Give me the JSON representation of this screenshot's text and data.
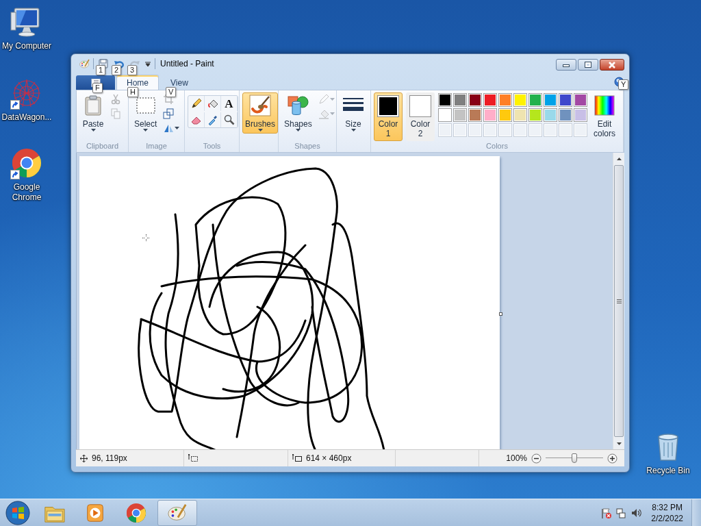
{
  "desktop_icons": [
    {
      "label": "My Computer",
      "kind": "computer",
      "shortcut": false
    },
    {
      "label": "DataWagon...",
      "kind": "datawagon",
      "shortcut": true
    },
    {
      "label": "Google Chrome",
      "kind": "chrome",
      "shortcut": true
    },
    {
      "label": "Recycle Bin",
      "kind": "recycle",
      "shortcut": false
    }
  ],
  "window": {
    "title": "Untitled - Paint",
    "quick_access": [
      {
        "kind": "save",
        "keytip": "1",
        "disabled": false
      },
      {
        "kind": "undo",
        "keytip": "2",
        "disabled": false
      },
      {
        "kind": "redo",
        "keytip": "3",
        "disabled": true
      }
    ],
    "file_tab": {
      "keytip": "F"
    },
    "tabs": [
      {
        "label": "Home",
        "keytip": "H",
        "selected": true
      },
      {
        "label": "View",
        "keytip": "V",
        "selected": false
      }
    ],
    "help_keytip": "Y",
    "ribbon_groups": [
      {
        "label": "Clipboard",
        "controls": [
          {
            "kind": "paste",
            "label": "Paste",
            "dropdown": true,
            "selected": false
          },
          {
            "kind": "icon_column",
            "icons": [
              {
                "kind": "cut",
                "disabled": true,
                "dropdown": false
              },
              {
                "kind": "copy",
                "disabled": true,
                "dropdown": false
              }
            ]
          }
        ]
      },
      {
        "label": "Image",
        "controls": [
          {
            "kind": "select",
            "label": "Select",
            "dropdown": true,
            "selected": false
          },
          {
            "kind": "icon_column",
            "icons": [
              {
                "kind": "crop",
                "disabled": true,
                "dropdown": false
              },
              {
                "kind": "resize",
                "disabled": false,
                "dropdown": false
              },
              {
                "kind": "rotate",
                "disabled": false,
                "dropdown": true
              }
            ]
          }
        ]
      },
      {
        "label": "Tools",
        "controls": [
          {
            "kind": "tool_grid",
            "tools": [
              {
                "kind": "pencil"
              },
              {
                "kind": "fill"
              },
              {
                "kind": "text",
                "glyph": "A"
              },
              {
                "kind": "eraser"
              },
              {
                "kind": "picker"
              },
              {
                "kind": "magnifier"
              }
            ]
          }
        ]
      },
      {
        "controls": [
          {
            "kind": "brush",
            "label": "Brushes",
            "dropdown": true,
            "selected": true
          }
        ]
      },
      {
        "label": "Shapes",
        "controls": [
          {
            "kind": "shapes",
            "label": "Shapes",
            "dropdown": true,
            "selected": false
          },
          {
            "kind": "icon_column",
            "icons": [
              {
                "kind": "outline",
                "disabled": true,
                "dropdown": true
              },
              {
                "kind": "shape_fill",
                "disabled": true,
                "dropdown": true
              }
            ]
          }
        ]
      },
      {
        "controls": [
          {
            "kind": "size",
            "label": "Size",
            "dropdown": true,
            "selected": false
          }
        ]
      },
      {
        "label": "Colors",
        "controls": [
          {
            "kind": "color_slot",
            "label": "Color 1",
            "color": "#000000",
            "selected": true
          },
          {
            "kind": "color_slot",
            "label": "Color 2",
            "color": "#ffffff",
            "selected": false
          },
          {
            "kind": "palette",
            "rows": [
              [
                {
                  "kind": "swatch",
                  "color": "#000000"
                },
                {
                  "kind": "swatch",
                  "color": "#7f7f7f"
                },
                {
                  "kind": "swatch",
                  "color": "#880015"
                },
                {
                  "kind": "swatch",
                  "color": "#ed1c24"
                },
                {
                  "kind": "swatch",
                  "color": "#ff7f27"
                },
                {
                  "kind": "swatch",
                  "color": "#fff200"
                },
                {
                  "kind": "swatch",
                  "color": "#22b14c"
                },
                {
                  "kind": "swatch",
                  "color": "#00a2e8"
                },
                {
                  "kind": "swatch",
                  "color": "#3f48cc"
                },
                {
                  "kind": "swatch",
                  "color": "#a349a4"
                }
              ],
              [
                {
                  "kind": "swatch",
                  "color": "#ffffff"
                },
                {
                  "kind": "swatch",
                  "color": "#c3c3c3"
                },
                {
                  "kind": "swatch",
                  "color": "#b97a57"
                },
                {
                  "kind": "swatch",
                  "color": "#ffaec9"
                },
                {
                  "kind": "swatch",
                  "color": "#ffc90e"
                },
                {
                  "kind": "swatch",
                  "color": "#efe4b0"
                },
                {
                  "kind": "swatch",
                  "color": "#b5e61d"
                },
                {
                  "kind": "swatch",
                  "color": "#99d9ea"
                },
                {
                  "kind": "swatch",
                  "color": "#7092be"
                },
                {
                  "kind": "swatch",
                  "color": "#c8bfe7"
                }
              ],
              [
                {
                  "kind": "empty"
                },
                {
                  "kind": "empty"
                },
                {
                  "kind": "empty"
                },
                {
                  "kind": "empty"
                },
                {
                  "kind": "empty"
                },
                {
                  "kind": "empty"
                },
                {
                  "kind": "empty"
                },
                {
                  "kind": "empty"
                },
                {
                  "kind": "empty"
                },
                {
                  "kind": "empty"
                }
              ]
            ]
          },
          {
            "kind": "spectrum",
            "label": "Edit colors",
            "dropdown": false,
            "selected": false
          }
        ]
      }
    ],
    "status_bar": {
      "cursor_position": "96, 119px",
      "canvas_size": "614 × 460px",
      "zoom": "100%",
      "zoom_slider": {
        "level": 0.5
      }
    }
  },
  "taskbar": {
    "items": [
      {
        "kind": "explorer",
        "active": false
      },
      {
        "kind": "media",
        "active": false
      },
      {
        "kind": "chrome",
        "active": false
      },
      {
        "kind": "paint",
        "active": true
      }
    ],
    "tray": [
      {
        "kind": "flag"
      },
      {
        "kind": "network"
      },
      {
        "kind": "volume"
      }
    ],
    "time": "8:32 PM",
    "date": "2/2/2022"
  }
}
